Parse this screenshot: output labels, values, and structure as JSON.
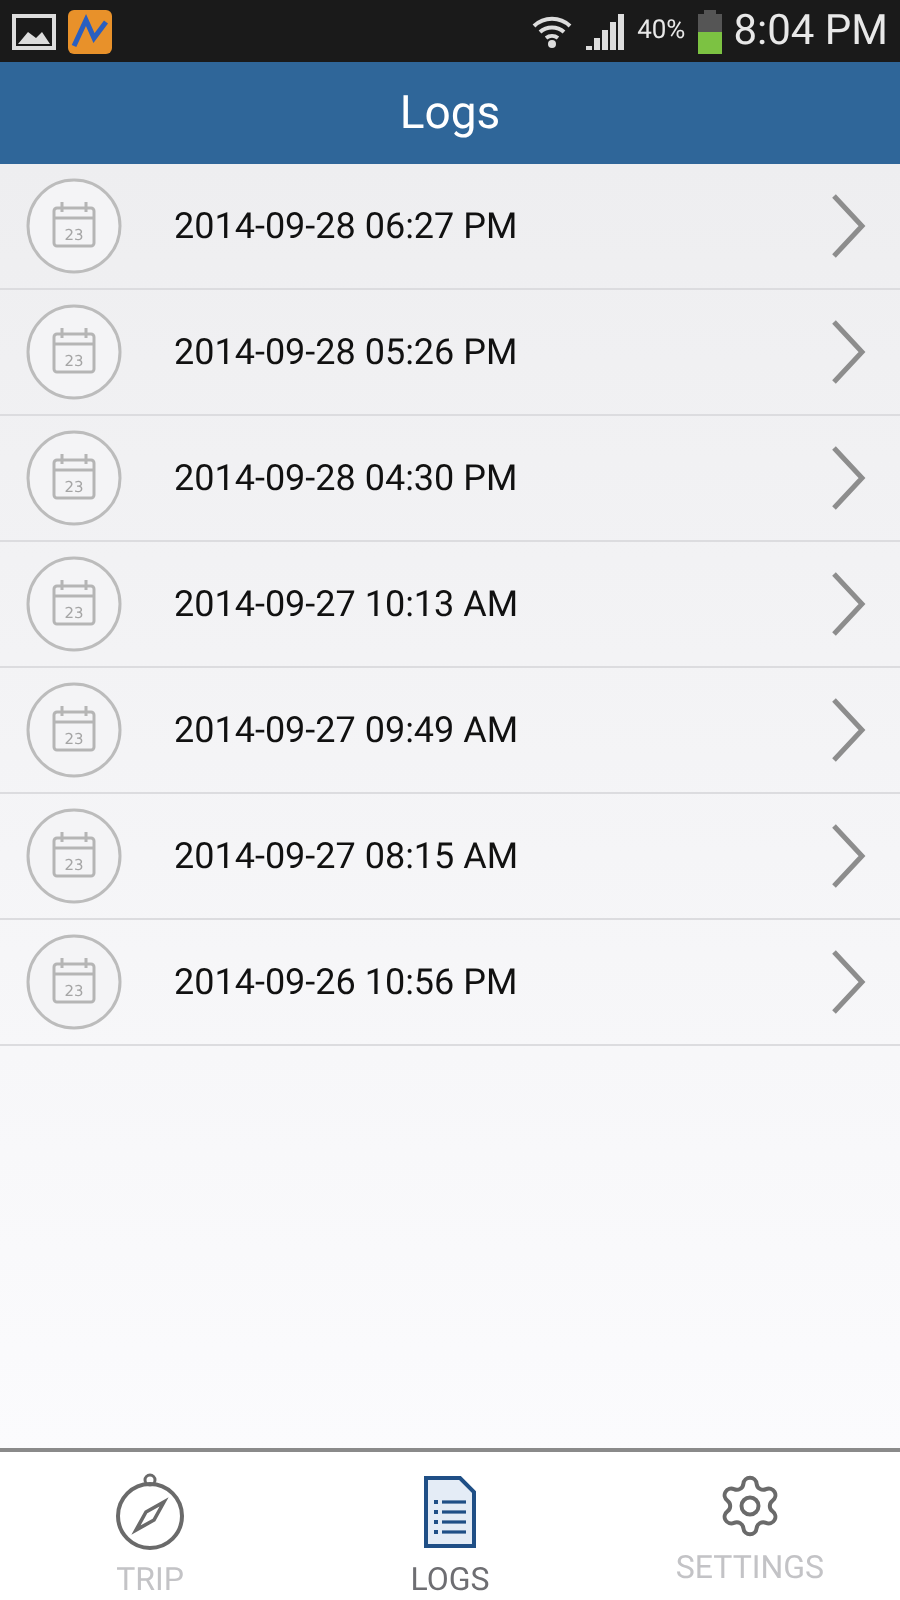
{
  "status_bar": {
    "battery": "40%",
    "time": "8:04 PM"
  },
  "header": {
    "title": "Logs"
  },
  "logs": [
    {
      "icon_day": "23",
      "label": "2014-09-28 06:27 PM"
    },
    {
      "icon_day": "23",
      "label": "2014-09-28 05:26 PM"
    },
    {
      "icon_day": "23",
      "label": "2014-09-28 04:30 PM"
    },
    {
      "icon_day": "23",
      "label": "2014-09-27 10:13 AM"
    },
    {
      "icon_day": "23",
      "label": "2014-09-27 09:49 AM"
    },
    {
      "icon_day": "23",
      "label": "2014-09-27 08:15 AM"
    },
    {
      "icon_day": "23",
      "label": "2014-09-26 10:56 PM"
    }
  ],
  "tabs": [
    {
      "kind": "trip",
      "label": "TRIP",
      "selected": false
    },
    {
      "kind": "logs",
      "label": "LOGS",
      "selected": true
    },
    {
      "kind": "settings",
      "label": "SETTINGS",
      "selected": false
    }
  ]
}
